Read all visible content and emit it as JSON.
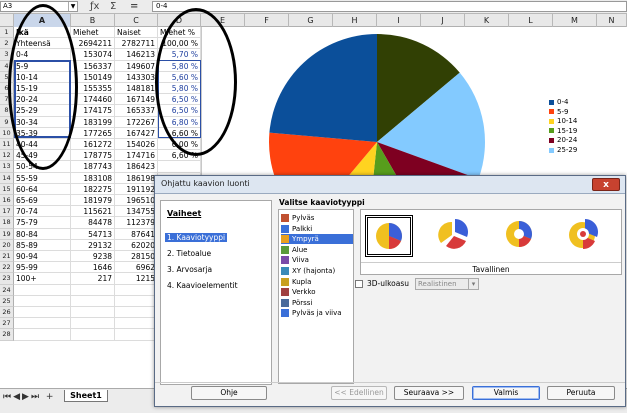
{
  "formula_bar": {
    "name_box": "A3",
    "input": "0-4"
  },
  "columns": [
    "A",
    "B",
    "C",
    "D",
    "E",
    "F",
    "G",
    "H",
    "I",
    "J",
    "K",
    "L",
    "M",
    "N"
  ],
  "rows": [
    {
      "n": "1",
      "a": "Ikä",
      "b": "Miehet",
      "c": "Naiset",
      "d": "Miehet %"
    },
    {
      "n": "2",
      "a": "Yhteensä",
      "b": "2694211",
      "c": "2782711",
      "d": "100,00 %"
    },
    {
      "n": "3",
      "a": "0-4",
      "b": "153074",
      "c": "146213",
      "d": "5,70 %"
    },
    {
      "n": "4",
      "a": "5-9",
      "b": "156337",
      "c": "149607",
      "d": "5,80 %"
    },
    {
      "n": "5",
      "a": "10-14",
      "b": "150149",
      "c": "143303",
      "d": "5,60 %"
    },
    {
      "n": "6",
      "a": "15-19",
      "b": "155355",
      "c": "148181",
      "d": "5,80 %"
    },
    {
      "n": "7",
      "a": "20-24",
      "b": "174460",
      "c": "167149",
      "d": "6,50 %"
    },
    {
      "n": "8",
      "a": "25-29",
      "b": "174175",
      "c": "165337",
      "d": "6,50 %"
    },
    {
      "n": "9",
      "a": "30-34",
      "b": "183199",
      "c": "172267",
      "d": "6,80 %"
    },
    {
      "n": "10",
      "a": "35-39",
      "b": "177265",
      "c": "167427",
      "d": "6,60 %"
    },
    {
      "n": "11",
      "a": "40-44",
      "b": "161272",
      "c": "154026",
      "d": "6,00 %"
    },
    {
      "n": "12",
      "a": "45-49",
      "b": "178775",
      "c": "174716",
      "d": "6,60 %"
    },
    {
      "n": "13",
      "a": "50-54",
      "b": "187743",
      "c": "186423",
      "d": ""
    },
    {
      "n": "14",
      "a": "55-59",
      "b": "183108",
      "c": "186198",
      "d": ""
    },
    {
      "n": "15",
      "a": "60-64",
      "b": "182275",
      "c": "191192",
      "d": ""
    },
    {
      "n": "16",
      "a": "65-69",
      "b": "181979",
      "c": "196510",
      "d": ""
    },
    {
      "n": "17",
      "a": "70-74",
      "b": "115621",
      "c": "134755",
      "d": ""
    },
    {
      "n": "18",
      "a": "75-79",
      "b": "84478",
      "c": "112379",
      "d": ""
    },
    {
      "n": "19",
      "a": "80-84",
      "b": "54713",
      "c": "87641",
      "d": ""
    },
    {
      "n": "20",
      "a": "85-89",
      "b": "29132",
      "c": "62020",
      "d": ""
    },
    {
      "n": "21",
      "a": "90-94",
      "b": "9238",
      "c": "28150",
      "d": ""
    },
    {
      "n": "22",
      "a": "95-99",
      "b": "1646",
      "c": "6962",
      "d": ""
    },
    {
      "n": "23",
      "a": "100+",
      "b": "217",
      "c": "1215",
      "d": ""
    },
    {
      "n": "24",
      "a": "",
      "b": "",
      "c": "",
      "d": ""
    },
    {
      "n": "25",
      "a": "",
      "b": "",
      "c": "",
      "d": ""
    },
    {
      "n": "26",
      "a": "",
      "b": "",
      "c": "",
      "d": ""
    },
    {
      "n": "27",
      "a": "",
      "b": "",
      "c": "",
      "d": ""
    },
    {
      "n": "28",
      "a": "",
      "b": "",
      "c": "",
      "d": ""
    }
  ],
  "chart": {
    "legend": [
      {
        "label": "0-4",
        "color": "#0b4f9a"
      },
      {
        "label": "5-9",
        "color": "#ff420e"
      },
      {
        "label": "10-14",
        "color": "#ffd320"
      },
      {
        "label": "15-19",
        "color": "#579d1c"
      },
      {
        "label": "20-24",
        "color": "#7e0021"
      },
      {
        "label": "25-29",
        "color": "#83caff"
      }
    ],
    "slice_colors": [
      "#314004",
      "#83caff",
      "#7e0021",
      "#579d1c",
      "#ffd320",
      "#ff420e",
      "#0b4f9a"
    ]
  },
  "sheet_tab": "Sheet1",
  "dialog": {
    "title": "Ohjattu kaavion luonti",
    "close": "x",
    "steps_heading": "Vaiheet",
    "steps": [
      "1. Kaaviotyyppi",
      "2. Tietoalue",
      "3. Arvosarja",
      "4. Kaavioelementit"
    ],
    "types_heading": "Valitse kaaviotyyppi",
    "types": [
      {
        "label": "Pylväs",
        "color": "#c05030"
      },
      {
        "label": "Palkki",
        "color": "#3a6fd8"
      },
      {
        "label": "Ympyrä",
        "color": "#e8a020"
      },
      {
        "label": "Alue",
        "color": "#5a9a3a"
      },
      {
        "label": "Viiva",
        "color": "#7a4aa8"
      },
      {
        "label": "XY (hajonta)",
        "color": "#3a8ab8"
      },
      {
        "label": "Kupla",
        "color": "#c8a020"
      },
      {
        "label": "Verkko",
        "color": "#a04040"
      },
      {
        "label": "Pörssi",
        "color": "#4a6a9a"
      },
      {
        "label": "Pylväs ja viiva",
        "color": "#3a6fd8"
      }
    ],
    "selected_type": 2,
    "subtype_label": "Tavallinen",
    "three_d_label": "3D-ulkoasu",
    "three_d_select": "Realistinen",
    "buttons": {
      "help": "Ohje",
      "back": "<< Edellinen",
      "next": "Seuraava >>",
      "finish": "Valmis",
      "cancel": "Peruuta"
    }
  }
}
